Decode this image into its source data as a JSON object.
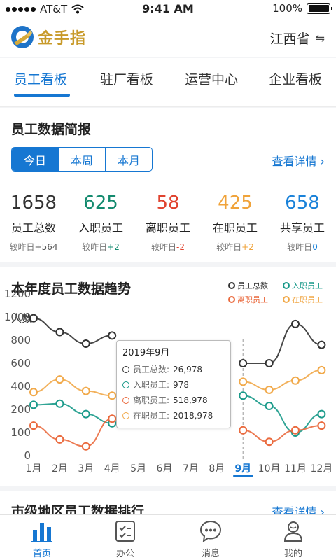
{
  "status_bar": {
    "carrier": "AT&T",
    "time": "9:41 AM",
    "battery": "100%"
  },
  "header": {
    "app_name": "金手指",
    "region": "江西省"
  },
  "tabs": [
    {
      "label": "员工看板",
      "active": true
    },
    {
      "label": "驻厂看板",
      "active": false
    },
    {
      "label": "运营中心",
      "active": false
    },
    {
      "label": "企业看板",
      "active": false
    }
  ],
  "summary": {
    "title": "员工数据简报",
    "periods": [
      "今日",
      "本周",
      "本月"
    ],
    "selected_period": "今日",
    "detail_link": "查看详情 ›",
    "stats": [
      {
        "value": "1658",
        "label": "员工总数",
        "compare_prefix": "较昨日",
        "delta": "+564",
        "color": "#333333",
        "delta_color": "#555555"
      },
      {
        "value": "625",
        "label": "入职员工",
        "compare_prefix": "较昨日",
        "delta": "+2",
        "color": "#138a6e",
        "delta_color": "#138a6e"
      },
      {
        "value": "58",
        "label": "离职员工",
        "compare_prefix": "较昨日",
        "delta": "-2",
        "color": "#e0432f",
        "delta_color": "#e0432f"
      },
      {
        "value": "425",
        "label": "在职员工",
        "compare_prefix": "较昨日",
        "delta": "+2",
        "color": "#f0a33a",
        "delta_color": "#f0a33a"
      },
      {
        "value": "658",
        "label": "共享员工",
        "compare_prefix": "较昨日",
        "delta": "0",
        "color": "#1a82d9",
        "delta_color": "#1a82d9"
      }
    ]
  },
  "trend": {
    "title": "本年度员工数据趋势",
    "unit_label": "人数",
    "tooltip": {
      "title": "2019年9月",
      "rows": [
        {
          "label": "员工总数:",
          "value": "26,978",
          "color": "#333333"
        },
        {
          "label": "入职员工:",
          "value": "978",
          "color": "#1a9a8a"
        },
        {
          "label": "离职员工:",
          "value": "518,978",
          "color": "#ea6a3e"
        },
        {
          "label": "在职员工:",
          "value": "2018,978",
          "color": "#f1a94a"
        }
      ]
    }
  },
  "chart_data": {
    "type": "line",
    "categories": [
      "1月",
      "2月",
      "3月",
      "4月",
      "5月",
      "6月",
      "7月",
      "8月",
      "9月",
      "10月",
      "11月",
      "12月"
    ],
    "highlighted_category": "9月",
    "ylim": [
      0,
      1200
    ],
    "yticks": [
      0,
      100,
      200,
      400,
      600,
      800,
      1000,
      1200
    ],
    "grid": false,
    "legend": "top-right",
    "series": [
      {
        "name": "员工总数",
        "color": "#333333",
        "values": [
          990,
          870,
          770,
          840,
          null,
          null,
          null,
          null,
          600,
          600,
          940,
          760
        ]
      },
      {
        "name": "入职员工",
        "color": "#1a9a8a",
        "values": [
          240,
          250,
          180,
          140,
          null,
          null,
          null,
          null,
          320,
          230,
          100,
          180
        ]
      },
      {
        "name": "离职员工",
        "color": "#ea6a3e",
        "values": [
          130,
          70,
          40,
          160,
          null,
          null,
          null,
          null,
          110,
          60,
          110,
          130
        ]
      },
      {
        "name": "在职员工",
        "color": "#f1a94a",
        "values": [
          350,
          460,
          360,
          320,
          null,
          null,
          null,
          null,
          440,
          370,
          450,
          540
        ]
      }
    ]
  },
  "ranking": {
    "title": "市级地区员工数据排行",
    "detail_link": "查看详情 ›"
  },
  "bottom_nav": [
    {
      "label": "首页",
      "icon": "bar-chart-icon",
      "active": true
    },
    {
      "label": "办公",
      "icon": "checklist-icon",
      "active": false
    },
    {
      "label": "消息",
      "icon": "chat-bubble-icon",
      "active": false
    },
    {
      "label": "我的",
      "icon": "user-icon",
      "active": false
    }
  ],
  "colors": {
    "accent": "#1677d2",
    "brand_gold": "#c89a2a"
  }
}
